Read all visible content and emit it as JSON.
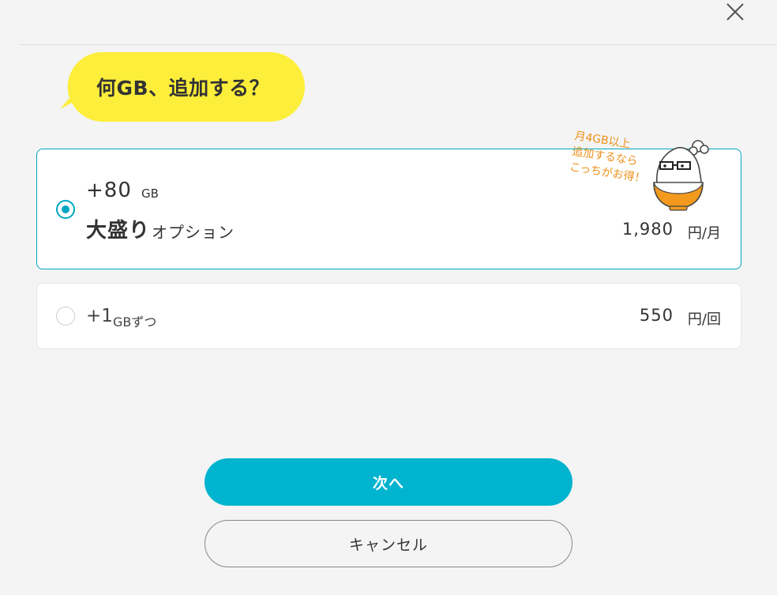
{
  "header": {
    "close_icon": "close-icon"
  },
  "bubble": {
    "text": "何GB、追加する？",
    "color": "#fcee3a"
  },
  "options": [
    {
      "selected": true,
      "amount": "+80",
      "unit": "GB",
      "name": "大盛り",
      "name_suffix": "オプション",
      "price": "1,980",
      "price_unit": "円/月",
      "promo_lines": [
        "月4GB以上",
        "追加するなら",
        "こっちがお得！"
      ],
      "mascot_icon": "rice-bowl-mascot-icon"
    },
    {
      "selected": false,
      "amount": "+1",
      "unit": "GBずつ",
      "price": "550",
      "price_unit": "円/回"
    }
  ],
  "buttons": {
    "next": "次へ",
    "cancel": "キャンセル"
  },
  "colors": {
    "accent": "#00b3cf",
    "border_selected": "#00a7c1",
    "promo_text": "#ec9019",
    "mascot_bowl": "#f39a1e"
  }
}
